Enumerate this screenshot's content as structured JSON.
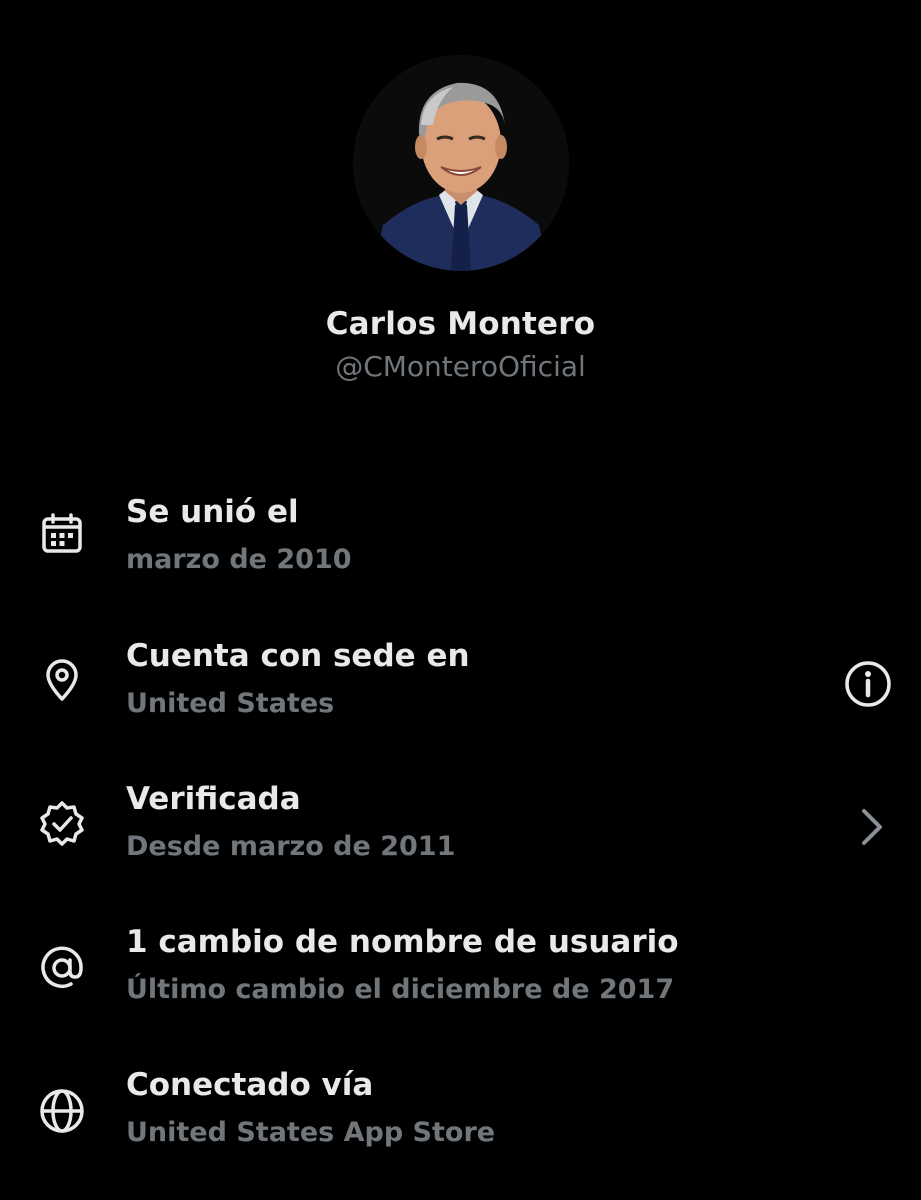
{
  "profile": {
    "name": "Carlos Montero",
    "handle": "@CMonteroOficial"
  },
  "rows": [
    {
      "title": "Se unió el",
      "subtitle": "marzo de 2010",
      "icon": "calendar-icon"
    },
    {
      "title": "Cuenta con sede en",
      "subtitle": "United States",
      "icon": "location-pin-icon",
      "action_icon": "info-icon"
    },
    {
      "title": "Verificada",
      "subtitle": "Desde marzo de 2011",
      "icon": "verified-badge-icon",
      "action_icon": "chevron-right-icon"
    },
    {
      "title": "1 cambio de nombre de usuario",
      "subtitle": "Último cambio el diciembre de 2017",
      "icon": "at-sign-icon"
    },
    {
      "title": "Conectado vía",
      "subtitle": "United States App Store",
      "icon": "globe-icon"
    }
  ],
  "colors": {
    "background": "#000000",
    "primary_text": "#e7e9ea",
    "secondary_text": "#71767b"
  }
}
